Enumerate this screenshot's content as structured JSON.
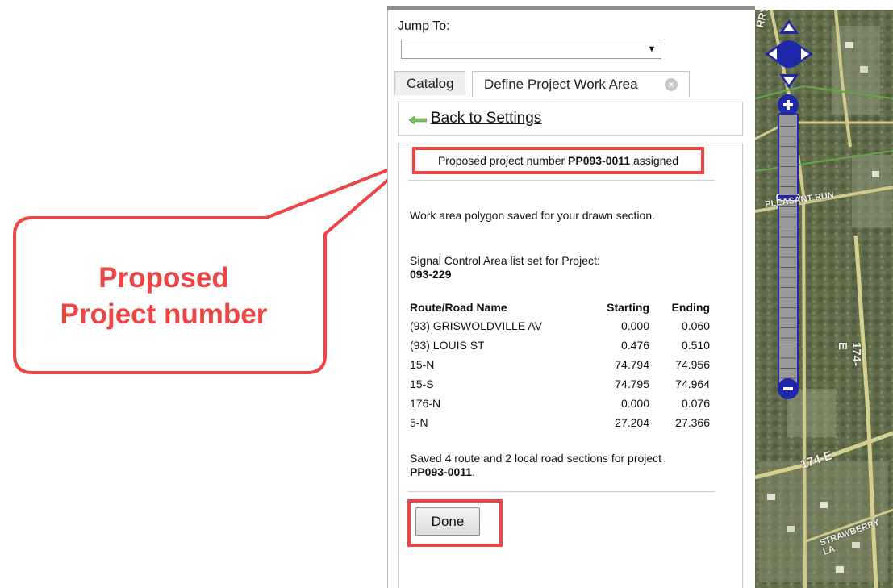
{
  "callout": {
    "line1": "Proposed",
    "line2": "Project number"
  },
  "panel": {
    "jump_to_label": "Jump To:",
    "jump_to_value": "",
    "tabs": [
      {
        "label": "Catalog",
        "active": false
      },
      {
        "label": "Define Project Work Area",
        "active": true
      }
    ],
    "back_link": "Back to Settings",
    "assigned": {
      "prefix": "Proposed project number",
      "number": "PP093-0011",
      "suffix": "assigned"
    },
    "polygon_msg": "Work area polygon saved for your drawn section.",
    "signal_label": "Signal Control Area list set for Project:",
    "signal_value": "093-229",
    "table": {
      "headers": [
        "Route/Road Name",
        "Starting",
        "Ending"
      ],
      "rows": [
        [
          "(93) GRISWOLDVILLE AV",
          "0.000",
          "0.060"
        ],
        [
          "(93) LOUIS ST",
          "0.476",
          "0.510"
        ],
        [
          "15-N",
          "74.794",
          "74.956"
        ],
        [
          "15-S",
          "74.795",
          "74.964"
        ],
        [
          "176-N",
          "0.000",
          "0.076"
        ],
        [
          "5-N",
          "27.204",
          "27.366"
        ]
      ]
    },
    "saved_msg": "Saved 4 route and 2 local road sections for project",
    "saved_project": "PP093-0011",
    "saved_period": ".",
    "done_label": "Done"
  },
  "map": {
    "labels": [
      "RRY R",
      "PLEASANT RUN",
      "174-E",
      "174-E",
      "STRAWBERRY LA"
    ],
    "zoom_level_fraction": 0.7
  },
  "colors": {
    "highlight": "#ee4444",
    "nav_blue": "#1e28a8"
  }
}
